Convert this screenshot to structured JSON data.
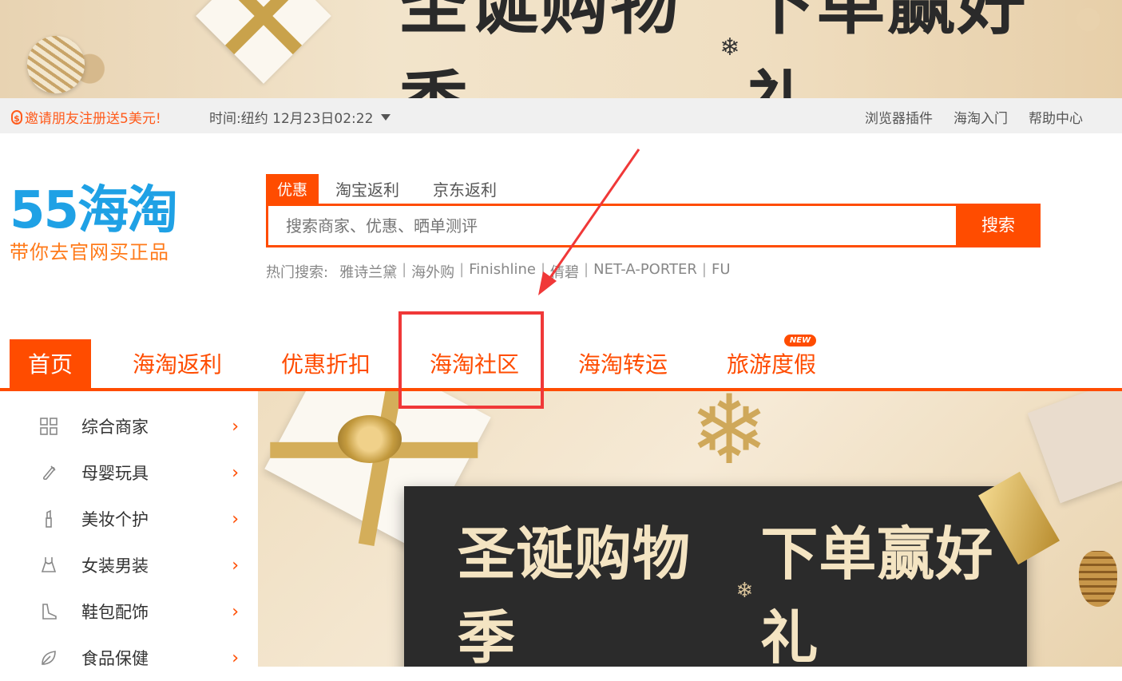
{
  "top_banner": {
    "title": "圣诞购物季",
    "title_sep": "❄",
    "title2": "下单赢好礼"
  },
  "topbar": {
    "invite_icon": "$",
    "invite": "邀请朋友注册送5美元!",
    "time_label": "时间:",
    "time_value": "纽约 12月23日02:22",
    "links": [
      "浏览器插件",
      "海淘入门",
      "帮助中心"
    ]
  },
  "logo": {
    "main": "55海淘",
    "sub": "带你去官网买正品"
  },
  "search": {
    "tabs": [
      "优惠",
      "淘宝返利",
      "京东返利"
    ],
    "placeholder": "搜索商家、优惠、晒单测评",
    "button": "搜索",
    "hot_label": "热门搜索:",
    "hot_items": [
      "雅诗兰黛",
      "海外购",
      "Finishline",
      "倩碧",
      "NET-A-PORTER",
      "FU"
    ]
  },
  "nav": {
    "items": [
      "首页",
      "海淘返利",
      "优惠折扣",
      "海淘社区",
      "海淘转运",
      "旅游度假"
    ],
    "new_badge": "NEW"
  },
  "sidebar": {
    "categories": [
      {
        "label": "综合商家",
        "icon": "grid-icon"
      },
      {
        "label": "母婴玩具",
        "icon": "baby-bottle-icon"
      },
      {
        "label": "美妆个护",
        "icon": "lipstick-icon"
      },
      {
        "label": "女装男装",
        "icon": "clothing-icon"
      },
      {
        "label": "鞋包配饰",
        "icon": "boot-icon"
      },
      {
        "label": "食品保健",
        "icon": "leaf-icon"
      }
    ]
  },
  "main_banner": {
    "title": "圣诞购物季",
    "title_sep": "❄",
    "title2": "下单赢好礼"
  },
  "colors": {
    "accent": "#ff4c00",
    "logo_blue": "#1fa1e5",
    "logo_orange": "#ff7a1a",
    "annotation_red": "#f03838"
  }
}
